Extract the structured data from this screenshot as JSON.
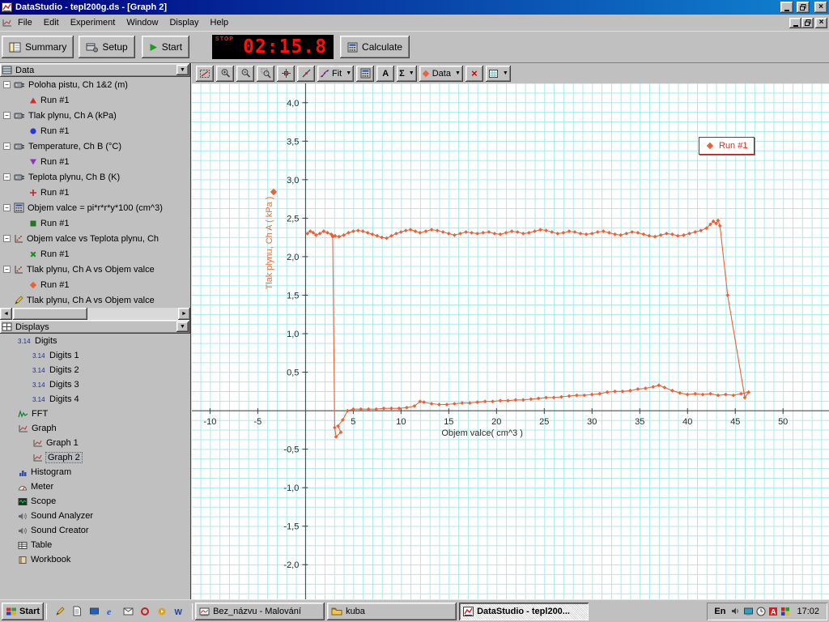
{
  "window": {
    "title": "DataStudio - tepl200g.ds - [Graph 2]",
    "menus": [
      "File",
      "Edit",
      "Experiment",
      "Window",
      "Display",
      "Help"
    ]
  },
  "toolbar": {
    "summary": "Summary",
    "setup": "Setup",
    "start": "Start",
    "calculate": "Calculate",
    "timer": {
      "stop": "STOP",
      "value": "02:15.8"
    }
  },
  "graph_toolbar": {
    "buttons": [
      {
        "name": "scale-to-fit",
        "icon": "scale-to-fit"
      },
      {
        "name": "zoom-in",
        "icon": "zoom-in"
      },
      {
        "name": "zoom-out",
        "icon": "zoom-out"
      },
      {
        "name": "zoom-select",
        "icon": "zoom-select"
      },
      {
        "name": "smart-tool",
        "icon": "smart-tool"
      },
      {
        "name": "slope-tool",
        "icon": "slope-tool"
      },
      {
        "name": "fit-menu",
        "icon": "fit",
        "label": "Fit",
        "dropdown": true
      },
      {
        "name": "calculate-tool",
        "icon": "calculator"
      },
      {
        "name": "text-tool",
        "label": "A",
        "cls": "bold"
      },
      {
        "name": "statistics-menu",
        "label": "Σ",
        "cls": "bold",
        "dropdown": true
      },
      {
        "name": "data-menu",
        "icon": "diamond-orange",
        "label": "Data",
        "dropdown": true
      },
      {
        "name": "remove-tool",
        "label": "×",
        "cls": "red"
      },
      {
        "name": "graph-settings-menu",
        "icon": "settings",
        "dropdown": true
      }
    ]
  },
  "sidebar": {
    "data_panel": {
      "title": "Data",
      "items": [
        {
          "label": "Poloha pistu, Ch 1&2 (m)",
          "icon": "sensor",
          "runs": [
            {
              "label": "Run #1",
              "marker": "triangle-red"
            }
          ]
        },
        {
          "label": "Tlak plynu, Ch A (kPa)",
          "icon": "sensor",
          "runs": [
            {
              "label": "Run #1",
              "marker": "circle-blue"
            }
          ]
        },
        {
          "label": "Temperature, Ch B (°C)",
          "icon": "sensor",
          "runs": [
            {
              "label": "Run #1",
              "marker": "triangle-purple"
            }
          ]
        },
        {
          "label": "Teplota plynu, Ch B (K)",
          "icon": "sensor",
          "runs": [
            {
              "label": "Run #1",
              "marker": "cross-red"
            }
          ]
        },
        {
          "label": "Objem valce = pi*r*r*y*100 (cm^3)",
          "icon": "calculator",
          "runs": [
            {
              "label": "Run #1",
              "marker": "square-green"
            }
          ]
        },
        {
          "label": "Objem valce vs Teplota plynu, Ch",
          "icon": "xy-data",
          "runs": [
            {
              "label": "Run #1",
              "marker": "x-green"
            }
          ]
        },
        {
          "label": "Tlak plynu, Ch A vs Objem valce",
          "icon": "xy-data",
          "runs": [
            {
              "label": "Run #1",
              "marker": "diamond-orange"
            }
          ]
        },
        {
          "label": "Tlak plynu, Ch A vs Objem valce",
          "icon": "pencil",
          "runs": []
        }
      ]
    },
    "displays_panel": {
      "title": "Displays",
      "items": [
        {
          "label": "Digits",
          "icon": "digits",
          "children": [
            {
              "label": "Digits 1",
              "icon": "digits"
            },
            {
              "label": "Digits 2",
              "icon": "digits"
            },
            {
              "label": "Digits 3",
              "icon": "digits"
            },
            {
              "label": "Digits 4",
              "icon": "digits"
            }
          ]
        },
        {
          "label": "FFT",
          "icon": "fft"
        },
        {
          "label": "Graph",
          "icon": "graph",
          "children": [
            {
              "label": "Graph 1",
              "icon": "graph"
            },
            {
              "label": "Graph 2",
              "icon": "graph",
              "selected": true
            }
          ]
        },
        {
          "label": "Histogram",
          "icon": "histogram"
        },
        {
          "label": "Meter",
          "icon": "meter"
        },
        {
          "label": "Scope",
          "icon": "scope"
        },
        {
          "label": "Sound Analyzer",
          "icon": "speaker"
        },
        {
          "label": "Sound Creator",
          "icon": "speaker"
        },
        {
          "label": "Table",
          "icon": "table"
        },
        {
          "label": "Workbook",
          "icon": "workbook"
        }
      ]
    }
  },
  "chart_data": {
    "type": "scatter",
    "title": "",
    "xlabel": "Objem valce( cm^3 )",
    "ylabel": "Tlak plynu, Ch A ( kPa )",
    "xlim": [
      -11.9,
      54.9
    ],
    "ylim": [
      -2.45,
      4.25
    ],
    "grid": true,
    "x_ticks": [
      {
        "v": -10,
        "t": "-10"
      },
      {
        "v": -5,
        "t": "-5"
      },
      {
        "v": 5,
        "t": "5"
      },
      {
        "v": 10,
        "t": "10"
      },
      {
        "v": 15,
        "t": "15"
      },
      {
        "v": 20,
        "t": "20"
      },
      {
        "v": 25,
        "t": "25"
      },
      {
        "v": 30,
        "t": "30"
      },
      {
        "v": 35,
        "t": "35"
      },
      {
        "v": 40,
        "t": "40"
      },
      {
        "v": 45,
        "t": "45"
      },
      {
        "v": 50,
        "t": "50"
      }
    ],
    "y_ticks": [
      {
        "v": 4,
        "t": "4,0"
      },
      {
        "v": 3.5,
        "t": "3,5"
      },
      {
        "v": 3,
        "t": "3,0"
      },
      {
        "v": 2.5,
        "t": "2,5"
      },
      {
        "v": 2,
        "t": "2,0"
      },
      {
        "v": 1.5,
        "t": "1,5"
      },
      {
        "v": 1,
        "t": "1,0"
      },
      {
        "v": 0.5,
        "t": "0,5"
      },
      {
        "v": -0.5,
        "t": "-0,5"
      },
      {
        "v": -1,
        "t": "-1,0"
      },
      {
        "v": -1.5,
        "t": "-1,5"
      },
      {
        "v": -2,
        "t": "-2,0"
      }
    ],
    "legend": {
      "label": "Run #1",
      "position": "top-right"
    },
    "series": [
      {
        "name": "Run #1",
        "color": "#eb6238",
        "marker": "diamond",
        "points": [
          [
            0.2,
            2.3
          ],
          [
            0.5,
            2.33
          ],
          [
            0.8,
            2.31
          ],
          [
            1.1,
            2.28
          ],
          [
            1.5,
            2.3
          ],
          [
            1.9,
            2.33
          ],
          [
            2.3,
            2.31
          ],
          [
            2.7,
            2.29
          ],
          [
            3.1,
            2.27
          ],
          [
            3.5,
            2.26
          ],
          [
            4.0,
            2.28
          ],
          [
            4.5,
            2.31
          ],
          [
            5.0,
            2.33
          ],
          [
            5.5,
            2.34
          ],
          [
            6.0,
            2.33
          ],
          [
            6.5,
            2.31
          ],
          [
            7.0,
            2.29
          ],
          [
            7.5,
            2.27
          ],
          [
            8.0,
            2.25
          ],
          [
            8.5,
            2.24
          ],
          [
            9.0,
            2.27
          ],
          [
            9.5,
            2.3
          ],
          [
            10.0,
            2.32
          ],
          [
            10.5,
            2.34
          ],
          [
            11.0,
            2.35
          ],
          [
            11.5,
            2.33
          ],
          [
            12.0,
            2.31
          ],
          [
            12.6,
            2.33
          ],
          [
            13.2,
            2.35
          ],
          [
            13.8,
            2.34
          ],
          [
            14.4,
            2.32
          ],
          [
            15.0,
            2.3
          ],
          [
            15.6,
            2.28
          ],
          [
            16.2,
            2.3
          ],
          [
            16.8,
            2.32
          ],
          [
            17.4,
            2.31
          ],
          [
            18.0,
            2.3
          ],
          [
            18.6,
            2.31
          ],
          [
            19.2,
            2.32
          ],
          [
            19.8,
            2.3
          ],
          [
            20.4,
            2.29
          ],
          [
            21.0,
            2.31
          ],
          [
            21.6,
            2.33
          ],
          [
            22.2,
            2.32
          ],
          [
            22.8,
            2.3
          ],
          [
            23.4,
            2.31
          ],
          [
            24.0,
            2.33
          ],
          [
            24.6,
            2.35
          ],
          [
            25.2,
            2.34
          ],
          [
            25.8,
            2.32
          ],
          [
            26.4,
            2.3
          ],
          [
            27.0,
            2.31
          ],
          [
            27.6,
            2.33
          ],
          [
            28.2,
            2.32
          ],
          [
            28.8,
            2.3
          ],
          [
            29.4,
            2.29
          ],
          [
            30.0,
            2.3
          ],
          [
            30.6,
            2.32
          ],
          [
            31.2,
            2.33
          ],
          [
            31.8,
            2.31
          ],
          [
            32.4,
            2.29
          ],
          [
            33.0,
            2.28
          ],
          [
            33.6,
            2.3
          ],
          [
            34.2,
            2.32
          ],
          [
            34.8,
            2.31
          ],
          [
            35.4,
            2.29
          ],
          [
            36.0,
            2.27
          ],
          [
            36.6,
            2.26
          ],
          [
            37.2,
            2.28
          ],
          [
            37.8,
            2.3
          ],
          [
            38.4,
            2.29
          ],
          [
            39.0,
            2.27
          ],
          [
            39.6,
            2.28
          ],
          [
            40.2,
            2.3
          ],
          [
            40.8,
            2.32
          ],
          [
            41.4,
            2.34
          ],
          [
            42.0,
            2.37
          ],
          [
            42.4,
            2.42
          ],
          [
            42.7,
            2.46
          ],
          [
            43.0,
            2.43
          ],
          [
            43.2,
            2.47
          ],
          [
            43.4,
            2.4
          ],
          [
            44.2,
            1.5
          ],
          [
            46.0,
            0.17
          ],
          [
            46.4,
            0.24
          ],
          [
            45.6,
            0.22
          ],
          [
            44.8,
            0.2
          ],
          [
            44.0,
            0.21
          ],
          [
            43.2,
            0.2
          ],
          [
            42.4,
            0.22
          ],
          [
            41.6,
            0.21
          ],
          [
            40.8,
            0.22
          ],
          [
            40.0,
            0.21
          ],
          [
            39.2,
            0.23
          ],
          [
            38.4,
            0.26
          ],
          [
            37.6,
            0.3
          ],
          [
            37.0,
            0.33
          ],
          [
            36.4,
            0.31
          ],
          [
            35.6,
            0.29
          ],
          [
            34.8,
            0.28
          ],
          [
            34.0,
            0.26
          ],
          [
            33.2,
            0.25
          ],
          [
            32.4,
            0.25
          ],
          [
            31.6,
            0.24
          ],
          [
            30.8,
            0.22
          ],
          [
            30.0,
            0.21
          ],
          [
            29.2,
            0.2
          ],
          [
            28.4,
            0.2
          ],
          [
            27.6,
            0.19
          ],
          [
            26.8,
            0.18
          ],
          [
            26.0,
            0.17
          ],
          [
            25.2,
            0.17
          ],
          [
            24.4,
            0.16
          ],
          [
            23.6,
            0.15
          ],
          [
            22.8,
            0.14
          ],
          [
            22.0,
            0.14
          ],
          [
            21.2,
            0.13
          ],
          [
            20.4,
            0.13
          ],
          [
            19.6,
            0.12
          ],
          [
            18.8,
            0.12
          ],
          [
            18.0,
            0.11
          ],
          [
            17.2,
            0.1
          ],
          [
            16.4,
            0.1
          ],
          [
            15.6,
            0.09
          ],
          [
            14.8,
            0.08
          ],
          [
            14.0,
            0.08
          ],
          [
            13.2,
            0.09
          ],
          [
            12.4,
            0.11
          ],
          [
            12.0,
            0.12
          ],
          [
            11.4,
            0.06
          ],
          [
            10.6,
            0.04
          ],
          [
            9.8,
            0.03
          ],
          [
            9.0,
            0.03
          ],
          [
            8.2,
            0.03
          ],
          [
            7.4,
            0.02
          ],
          [
            6.6,
            0.02
          ],
          [
            5.8,
            0.02
          ],
          [
            5.0,
            0.02
          ],
          [
            4.4,
            0.0
          ],
          [
            3.9,
            -0.12
          ],
          [
            3.4,
            -0.2
          ],
          [
            3.7,
            -0.28
          ],
          [
            3.2,
            -0.34
          ],
          [
            3.05,
            -0.22
          ],
          [
            2.85,
            2.26
          ]
        ]
      }
    ]
  },
  "taskbar": {
    "start_label": "Start",
    "quick_launch": [
      "pencil",
      "document",
      "show-desktop",
      "ie",
      "mail",
      "opera",
      "media-player",
      "word"
    ],
    "tasks": [
      {
        "label": "Bez_názvu - Malování",
        "icon": "paint",
        "active": false
      },
      {
        "label": "kuba",
        "icon": "folder",
        "active": false
      },
      {
        "label": "DataStudio - tepl200...",
        "icon": "datastudio",
        "active": true
      }
    ],
    "tray": {
      "lang": "En",
      "icons": [
        "volume",
        "display",
        "clock-tray",
        "antivirus",
        "colors"
      ],
      "time": "17:02"
    }
  }
}
